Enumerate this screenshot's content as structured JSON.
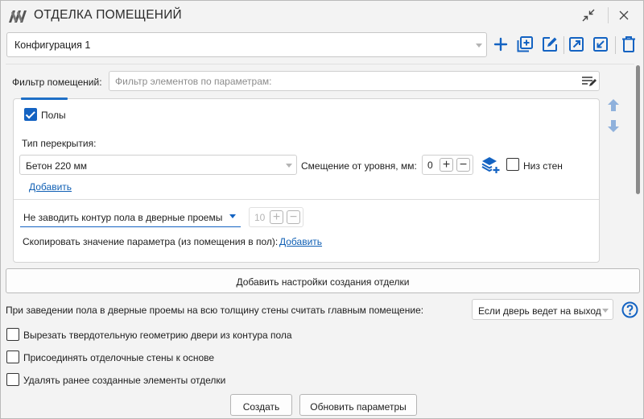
{
  "window": {
    "title": "ОТДЕЛКА ПОМЕЩЕНИЙ",
    "icons": {
      "logo": "app-logo-icon",
      "collapse": "collapse-arrows-icon",
      "close": "close-icon"
    }
  },
  "config": {
    "selected": "Конфигурация 1",
    "toolbar_icons": [
      "add-icon",
      "duplicate-icon",
      "edit-icon",
      "export-icon",
      "import-icon",
      "delete-icon"
    ]
  },
  "filter": {
    "label": "Фильтр помещений:",
    "placeholder": "Фильтр элементов по параметрам:",
    "icon": "filter-edit-icon"
  },
  "floor_card": {
    "enabled_label": "Полы",
    "enabled": true,
    "floor_type_label": "Тип перекрытия:",
    "floor_type_value": "Бетон 220 мм",
    "offset_label": "Смещение от уровня, мм:",
    "offset_value": "0",
    "layers_icon": "add-layer-icon",
    "bottom_walls_label": "Низ стен",
    "bottom_walls_checked": false,
    "add_link": "Добавить",
    "door_contour_value": "Не заводить контур пола в дверные проемы",
    "door_offset_value": "10",
    "copy_param_label": "Скопировать значение параметра (из помещения в пол):",
    "copy_param_link": "Добавить"
  },
  "move_icons": [
    "move-up-icon",
    "move-down-icon"
  ],
  "add_settings_button": "Добавить настройки создания отделки",
  "main_room": {
    "label": "При заведении пола в дверные проемы на всю толщину стены считать главным помещение:",
    "value": "Если дверь ведет на выход",
    "help_icon": "help-icon"
  },
  "options": [
    {
      "label": "Вырезать твердотельную геометрию двери из контура пола",
      "checked": false
    },
    {
      "label": "Присоединять отделочные стены к основе",
      "checked": false
    },
    {
      "label": "Удалять ранее созданные элементы отделки",
      "checked": false
    }
  ],
  "buttons": {
    "create": "Создать",
    "update": "Обновить параметры"
  },
  "colors": {
    "accent": "#1463c2",
    "link": "#0f5fb4",
    "background": "#f3f3f3"
  }
}
